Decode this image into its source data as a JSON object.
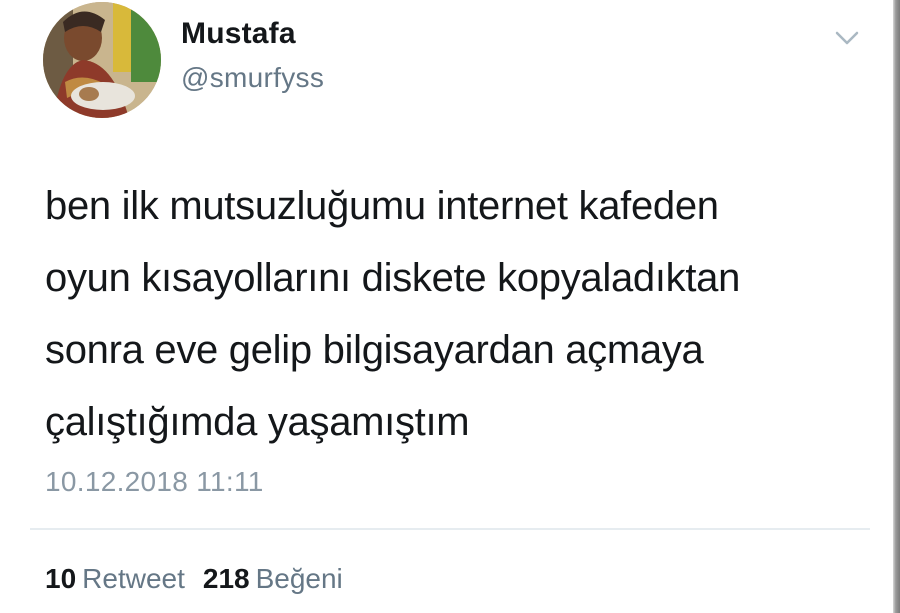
{
  "author": {
    "display_name": "Mustafa",
    "handle": "@smurfyss"
  },
  "icons": {
    "avatar": "user-avatar-photo",
    "menu": "chevron-down-icon"
  },
  "tweet": {
    "text": "ben ilk mutsuzluğumu internet kafeden\noyun kısayollarını diskete kopyaladıktan\nsonra eve gelip bilgisayardan açmaya\nçalıştığımda yaşamıştım",
    "timestamp": "10.12.2018 11:11"
  },
  "stats": {
    "retweets_count": "10",
    "retweets_label": "Retweet",
    "likes_count": "218",
    "likes_label": "Beğeni"
  },
  "colors": {
    "text_primary": "#14171a",
    "text_secondary": "#657786",
    "divider": "#e6ecf0"
  }
}
